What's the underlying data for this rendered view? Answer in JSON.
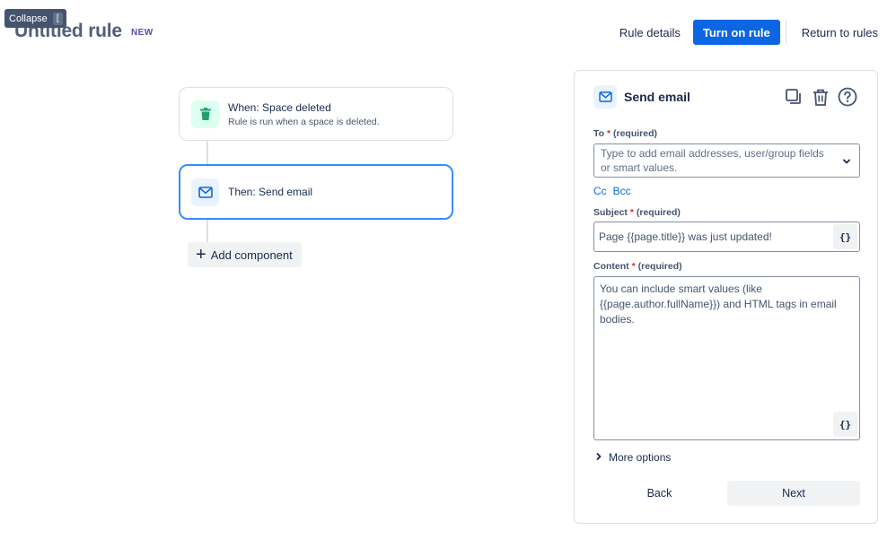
{
  "tooltip": {
    "label": "Collapse",
    "shortcut": "["
  },
  "header": {
    "title": "Untitled rule",
    "badge": "NEW",
    "rule_details": "Rule details",
    "turn_on": "Turn on rule",
    "return": "Return to rules"
  },
  "flow": {
    "trigger": {
      "title": "When: Space deleted",
      "description": "Rule is run when a space is deleted.",
      "icon": "trash-icon"
    },
    "action": {
      "title": "Then: Send email",
      "icon": "email-icon"
    },
    "add_component": "Add component"
  },
  "panel": {
    "title": "Send email",
    "icon": "email-icon",
    "to": {
      "label": "To",
      "required": "(required)",
      "placeholder": "Type to add email addresses, user/group fields or smart values."
    },
    "cc": "Cc",
    "bcc": "Bcc",
    "subject": {
      "label": "Subject",
      "required": "(required)",
      "value": "Page {{page.title}} was just updated!"
    },
    "content": {
      "label": "Content",
      "required": "(required)",
      "placeholder": "You can include smart values (like {{page.author.fullName}}) and HTML tags in email bodies."
    },
    "smart_value_glyph": "{}",
    "more_options": "More options",
    "back": "Back",
    "next": "Next"
  },
  "colors": {
    "primary": "#0c66e4",
    "selected_border": "#388bff",
    "required": "#c9372c",
    "trigger_icon": "#22a06b"
  }
}
